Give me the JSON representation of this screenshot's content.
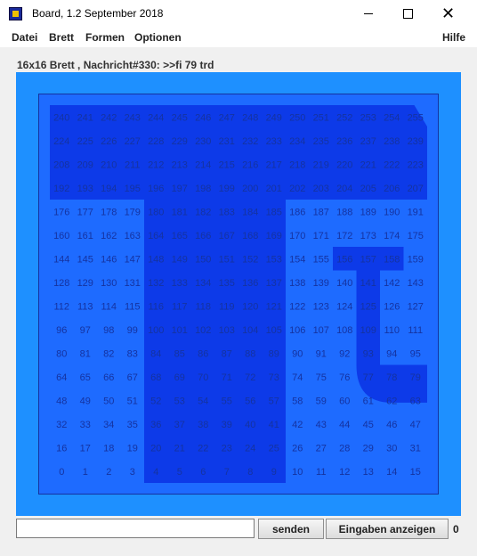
{
  "window": {
    "title": "Board, 1.2 September 2018"
  },
  "menu": [
    "Datei",
    "Brett",
    "Formen",
    "Optionen",
    "Hilfe"
  ],
  "info": "16x16 Brett , Nachricht#330: >>fi 79 trd",
  "board": {
    "size": 16,
    "colors": {
      "outer": "#1e90ff",
      "cell": "#1e6bff",
      "dark": "#0d3ae8",
      "number": "#1533a0"
    }
  },
  "input": {
    "value": "",
    "placeholder": ""
  },
  "buttons": {
    "send": "senden",
    "show_inputs": "Eingaben anzeigen"
  },
  "counter": "0"
}
